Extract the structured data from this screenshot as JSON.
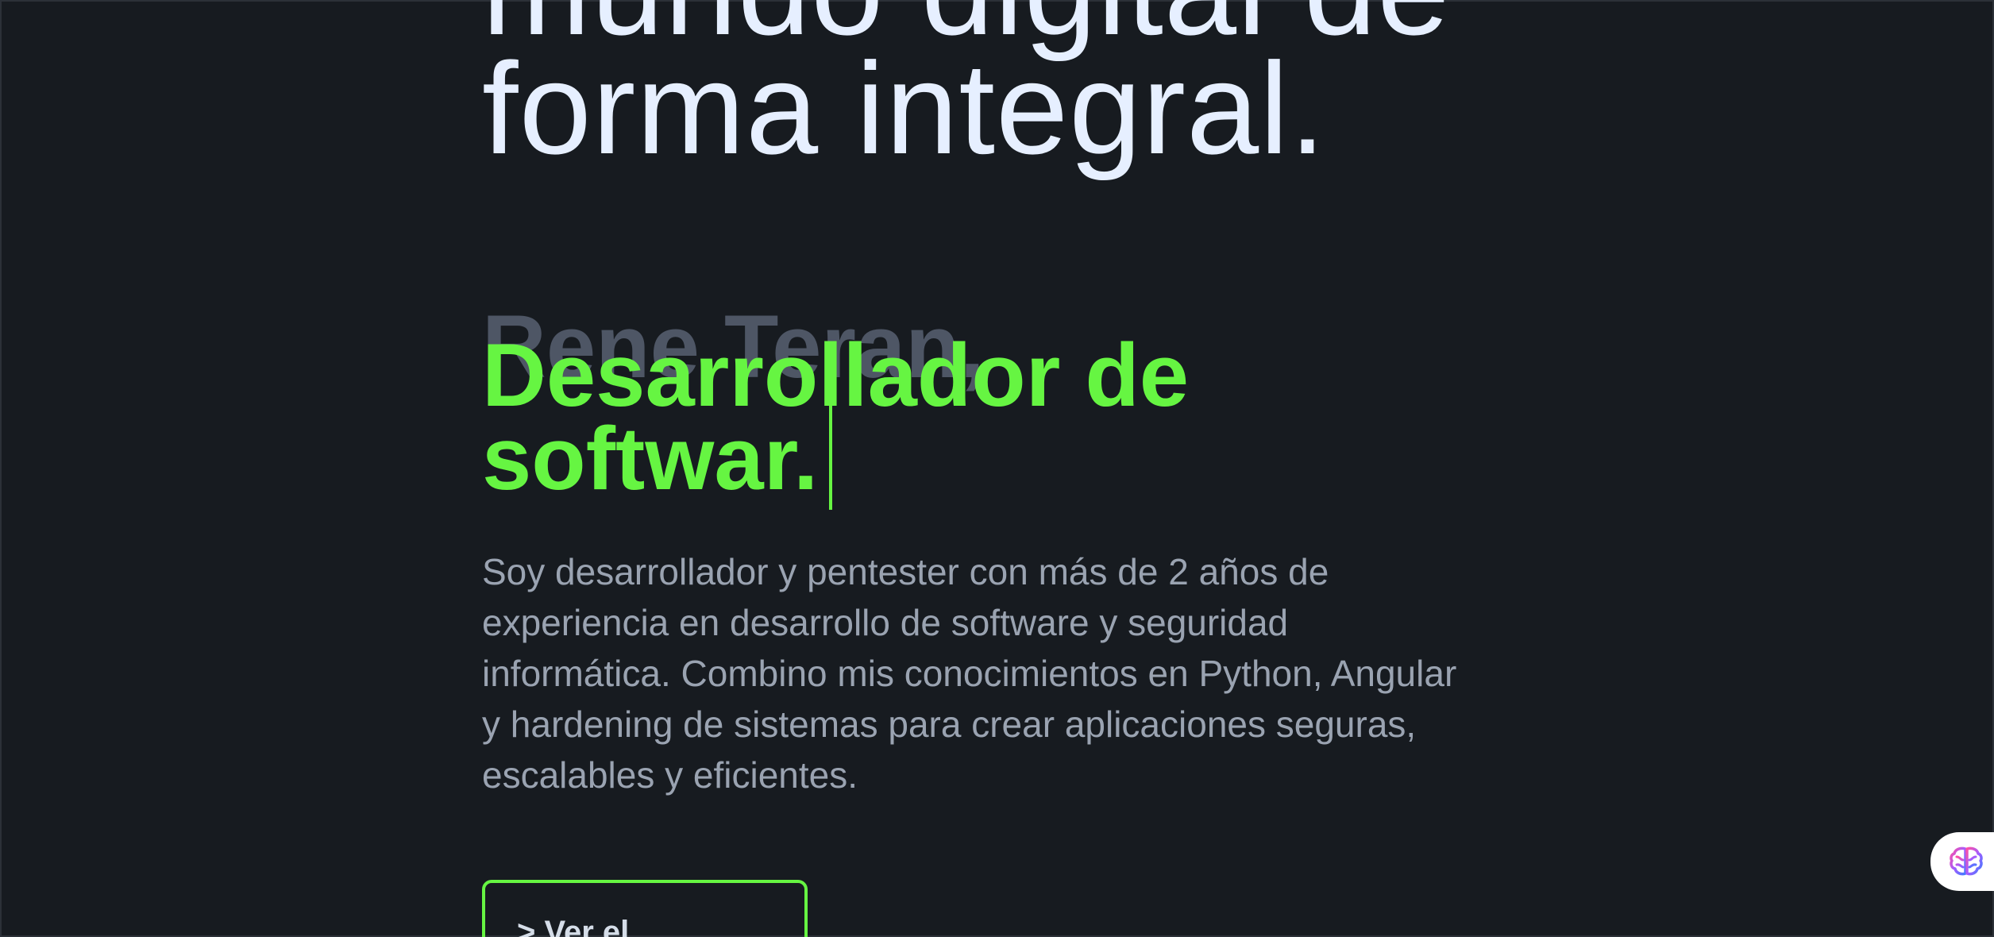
{
  "hero": {
    "headline_lines": [
      "mundo digital de",
      "forma integral."
    ],
    "name": "Rene Teran,",
    "role_lines": [
      "Desarrollador de",
      "softwar."
    ],
    "bio": "Soy desarrollador y pentester con más de 2 años de experiencia en desarrollo de software y seguridad informática. Combino mis conocimientos en Python, Angular y hardening de sistemas para crear aplicaciones seguras, escalables y eficientes.",
    "cta_label": "> Ver el Portafolio"
  },
  "widget": {
    "icon": "brain-icon"
  },
  "colors": {
    "background": "#171b20",
    "headline": "#e6efff",
    "name": "#4e5665",
    "accent": "#66f542",
    "bio": "#9aa3b1"
  }
}
